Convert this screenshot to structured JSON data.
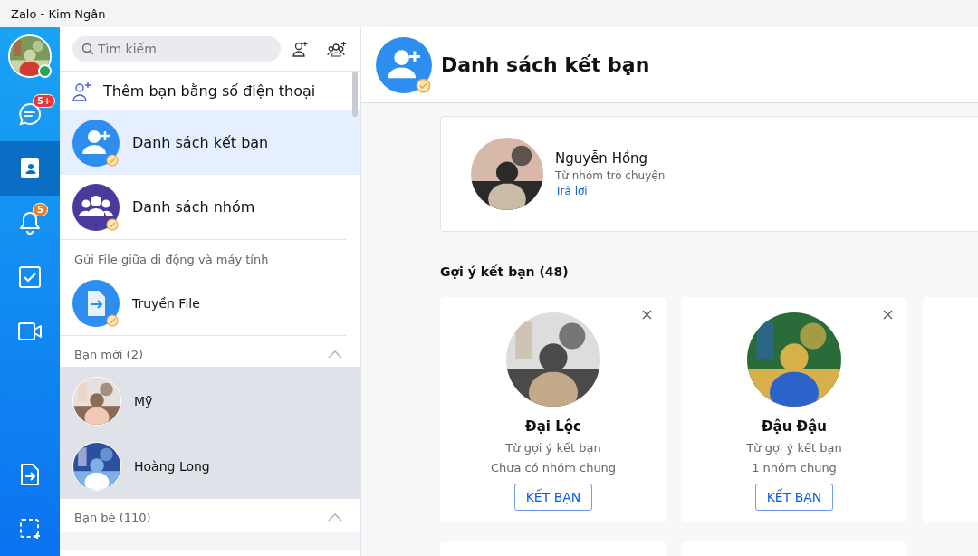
{
  "window": {
    "title": "Zalo - Kim Ngân"
  },
  "nav": {
    "avatar": {
      "online": true
    },
    "items": [
      {
        "kind": "chat",
        "selected": false,
        "badge": "5+",
        "color": "#e5383b"
      },
      {
        "kind": "contacts",
        "selected": true
      },
      {
        "kind": "bell",
        "selected": false,
        "badge": "5",
        "color": "#f47b20"
      },
      {
        "kind": "todo",
        "selected": false
      },
      {
        "kind": "video",
        "selected": false
      }
    ],
    "bottom": [
      {
        "kind": "file"
      },
      {
        "kind": "capture"
      }
    ]
  },
  "contacts": {
    "search": {
      "placeholder": "Tìm kiếm"
    },
    "add_phone": "Thêm bạn bằng số điện thoại",
    "items": [
      {
        "kind": "friends",
        "label": "Danh sách kết bạn",
        "selected": true
      },
      {
        "kind": "groups",
        "label": "Danh sách nhóm",
        "selected": false
      }
    ],
    "file_section": {
      "title": "Gửi File giữa di động và máy tính",
      "item": "Truyền File"
    },
    "sections": [
      {
        "title": "Bạn mới (2)",
        "expanded": true,
        "highlighted": true,
        "rows": [
          {
            "name": "Mỹ"
          },
          {
            "name": "Hoàng Long"
          }
        ]
      },
      {
        "title": "Bạn bè (110)",
        "expanded": true,
        "highlighted": false
      }
    ]
  },
  "main": {
    "title": "Danh sách kết bạn",
    "request": {
      "name": "Nguyễn Hồng",
      "source": "Từ nhóm trò chuyện",
      "action": "Trả lời"
    },
    "suggest_title": "Gợi ý kết bạn (48)",
    "suggestions": [
      {
        "name": "Đại Lộc",
        "source": "Từ gợi ý kết bạn",
        "groups": "Chưa có nhóm chung",
        "button": "KẾT BẠN"
      },
      {
        "name": "Đậu Đậu",
        "source": "Từ gợi ý kết bạn",
        "groups": "1 nhóm chung",
        "button": "KẾT BẠN"
      }
    ]
  }
}
